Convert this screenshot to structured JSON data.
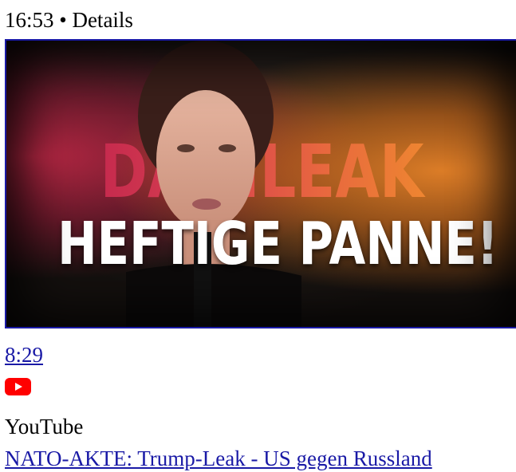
{
  "header": {
    "time": "16:53",
    "separator": "•",
    "label": "Details",
    "text": "16:53 • Details"
  },
  "video": {
    "thumbnail_text_line1": "DATENLEAK",
    "thumbnail_text_line1_visible": "DA  NLEAK",
    "thumbnail_text_line2": "HEFTIGE PANNE!",
    "duration": "8:29",
    "source_icon": "youtube-icon",
    "source_name": "YouTube",
    "title": "NATO-AKTE: Trump-Leak - US gegen Russland"
  },
  "colors": {
    "link": "#1a1aa6",
    "youtube_red": "#ff0000",
    "thumb_gradient_left": "#c0224e",
    "thumb_gradient_right": "#f0902c"
  }
}
